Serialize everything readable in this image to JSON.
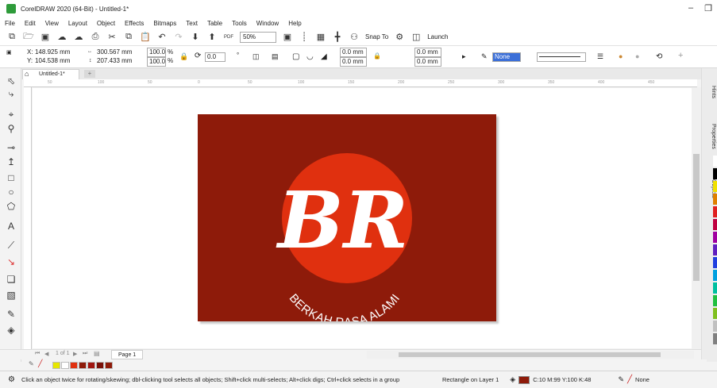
{
  "window": {
    "title": "CorelDRAW 2020 (64-Bit) - Untitled-1*",
    "controls": [
      "minimize",
      "restore"
    ]
  },
  "menu": [
    "File",
    "Edit",
    "View",
    "Layout",
    "Object",
    "Effects",
    "Bitmaps",
    "Text",
    "Table",
    "Tools",
    "Window",
    "Help"
  ],
  "standard_toolbar": {
    "zoom": "50%",
    "snap_to": "Snap To",
    "launch": "Launch",
    "pdf_label": "PDF"
  },
  "property_bar": {
    "x": "148.925 mm",
    "y": "104.538 mm",
    "width": "300.567 mm",
    "height": "207.433 mm",
    "scale_w": "100.0",
    "scale_h": "100.0",
    "percent": "%",
    "angle": "0.0",
    "degree": "°",
    "corner_1": "0.0 mm",
    "corner_2": "0.0 mm",
    "corner_3": "0.0 mm",
    "corner_4": "0.0 mm",
    "outline_width": "None"
  },
  "document_tab": "Untitled-1*",
  "ruler": {
    "h_ticks": [
      "50",
      "100",
      "50",
      "0",
      "50",
      "100",
      "150",
      "200",
      "250",
      "300",
      "350",
      "400",
      "450"
    ],
    "units": "millimeters"
  },
  "artwork": {
    "background_color": "#8e1b0a",
    "circle_color": "#e0300f",
    "logo_letters": "BR",
    "tagline": "BERKAH RASA ALAMI"
  },
  "dockers": [
    "Hints",
    "Properties",
    "Objects"
  ],
  "page_nav": {
    "info": "1 of 1",
    "page_label": "Page 1"
  },
  "status": {
    "hint": "Click an object twice for rotating/skewing; dbl-clicking tool selects all objects; Shift+click multi-selects; Alt+click digs; Ctrl+click selects in a group",
    "selection": "Rectangle on Layer 1",
    "fill": "C:10 M:99 Y:100 K:48",
    "fill_color": "#8e1b0a",
    "outline": "None"
  },
  "doc_palette_colors": [
    "#e6e600",
    "#ffffff",
    "#e0300f",
    "#8e1b0a",
    "#a01510",
    "#7a1008",
    "#8e1b0a"
  ],
  "color_palette": [
    "#ffffff",
    "#000000",
    "#f0e000",
    "#e08000",
    "#e02020",
    "#c00040",
    "#a000a0",
    "#6020c0",
    "#2040e0",
    "#00a0e0",
    "#00c0a0",
    "#20c040",
    "#80c020",
    "#c0c0c0",
    "#808080"
  ]
}
